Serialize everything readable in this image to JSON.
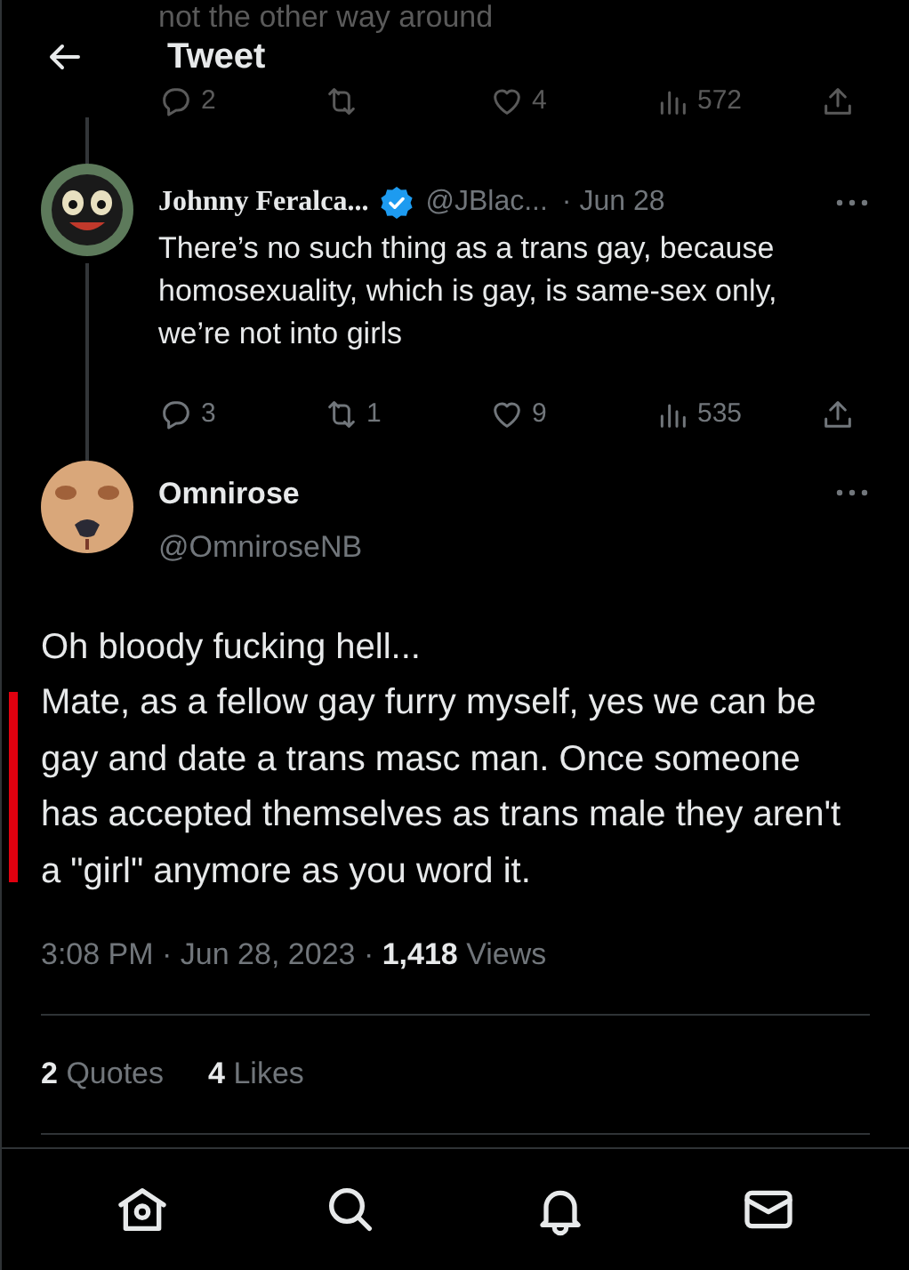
{
  "background_tweet": {
    "text": "not the other way around",
    "actions": [
      {
        "kind": "reply",
        "count": "2"
      },
      {
        "kind": "retweet"
      },
      {
        "kind": "like",
        "count": "4"
      },
      {
        "kind": "views",
        "count": "572"
      },
      {
        "kind": "share"
      }
    ]
  },
  "header": {
    "title": "Tweet"
  },
  "parent_tweet": {
    "name": "Johnny Feralca...",
    "verified": true,
    "handle": "@JBlac...",
    "date": "· Jun 28",
    "text": "There’s no such thing as a trans gay, because homosexuality, which is gay, is same-sex only, we’re not into girls",
    "actions": [
      {
        "kind": "reply",
        "count": "3"
      },
      {
        "kind": "retweet",
        "count": "1"
      },
      {
        "kind": "like",
        "count": "9"
      },
      {
        "kind": "views",
        "count": "535"
      },
      {
        "kind": "share"
      }
    ]
  },
  "main_tweet": {
    "name": "Omnirose",
    "handle": "@OmniroseNB",
    "paragraphs": [
      "Oh bloody fucking hell...",
      "Mate, as a fellow gay furry myself, yes we can be gay and date a trans masc man. Once someone has accepted themselves as trans male they aren't a \"girl\" anymore as you word it."
    ],
    "timestamp": "3:08 PM · Jun 28, 2023 · ",
    "views_count": "1,418",
    "views_label": " Views",
    "stats": [
      {
        "count": "2",
        "label": "Quotes"
      },
      {
        "count": "4",
        "label": "Likes"
      }
    ]
  },
  "bottom_nav": [
    {
      "kind": "home"
    },
    {
      "kind": "search"
    },
    {
      "kind": "notifications"
    },
    {
      "kind": "messages"
    }
  ]
}
